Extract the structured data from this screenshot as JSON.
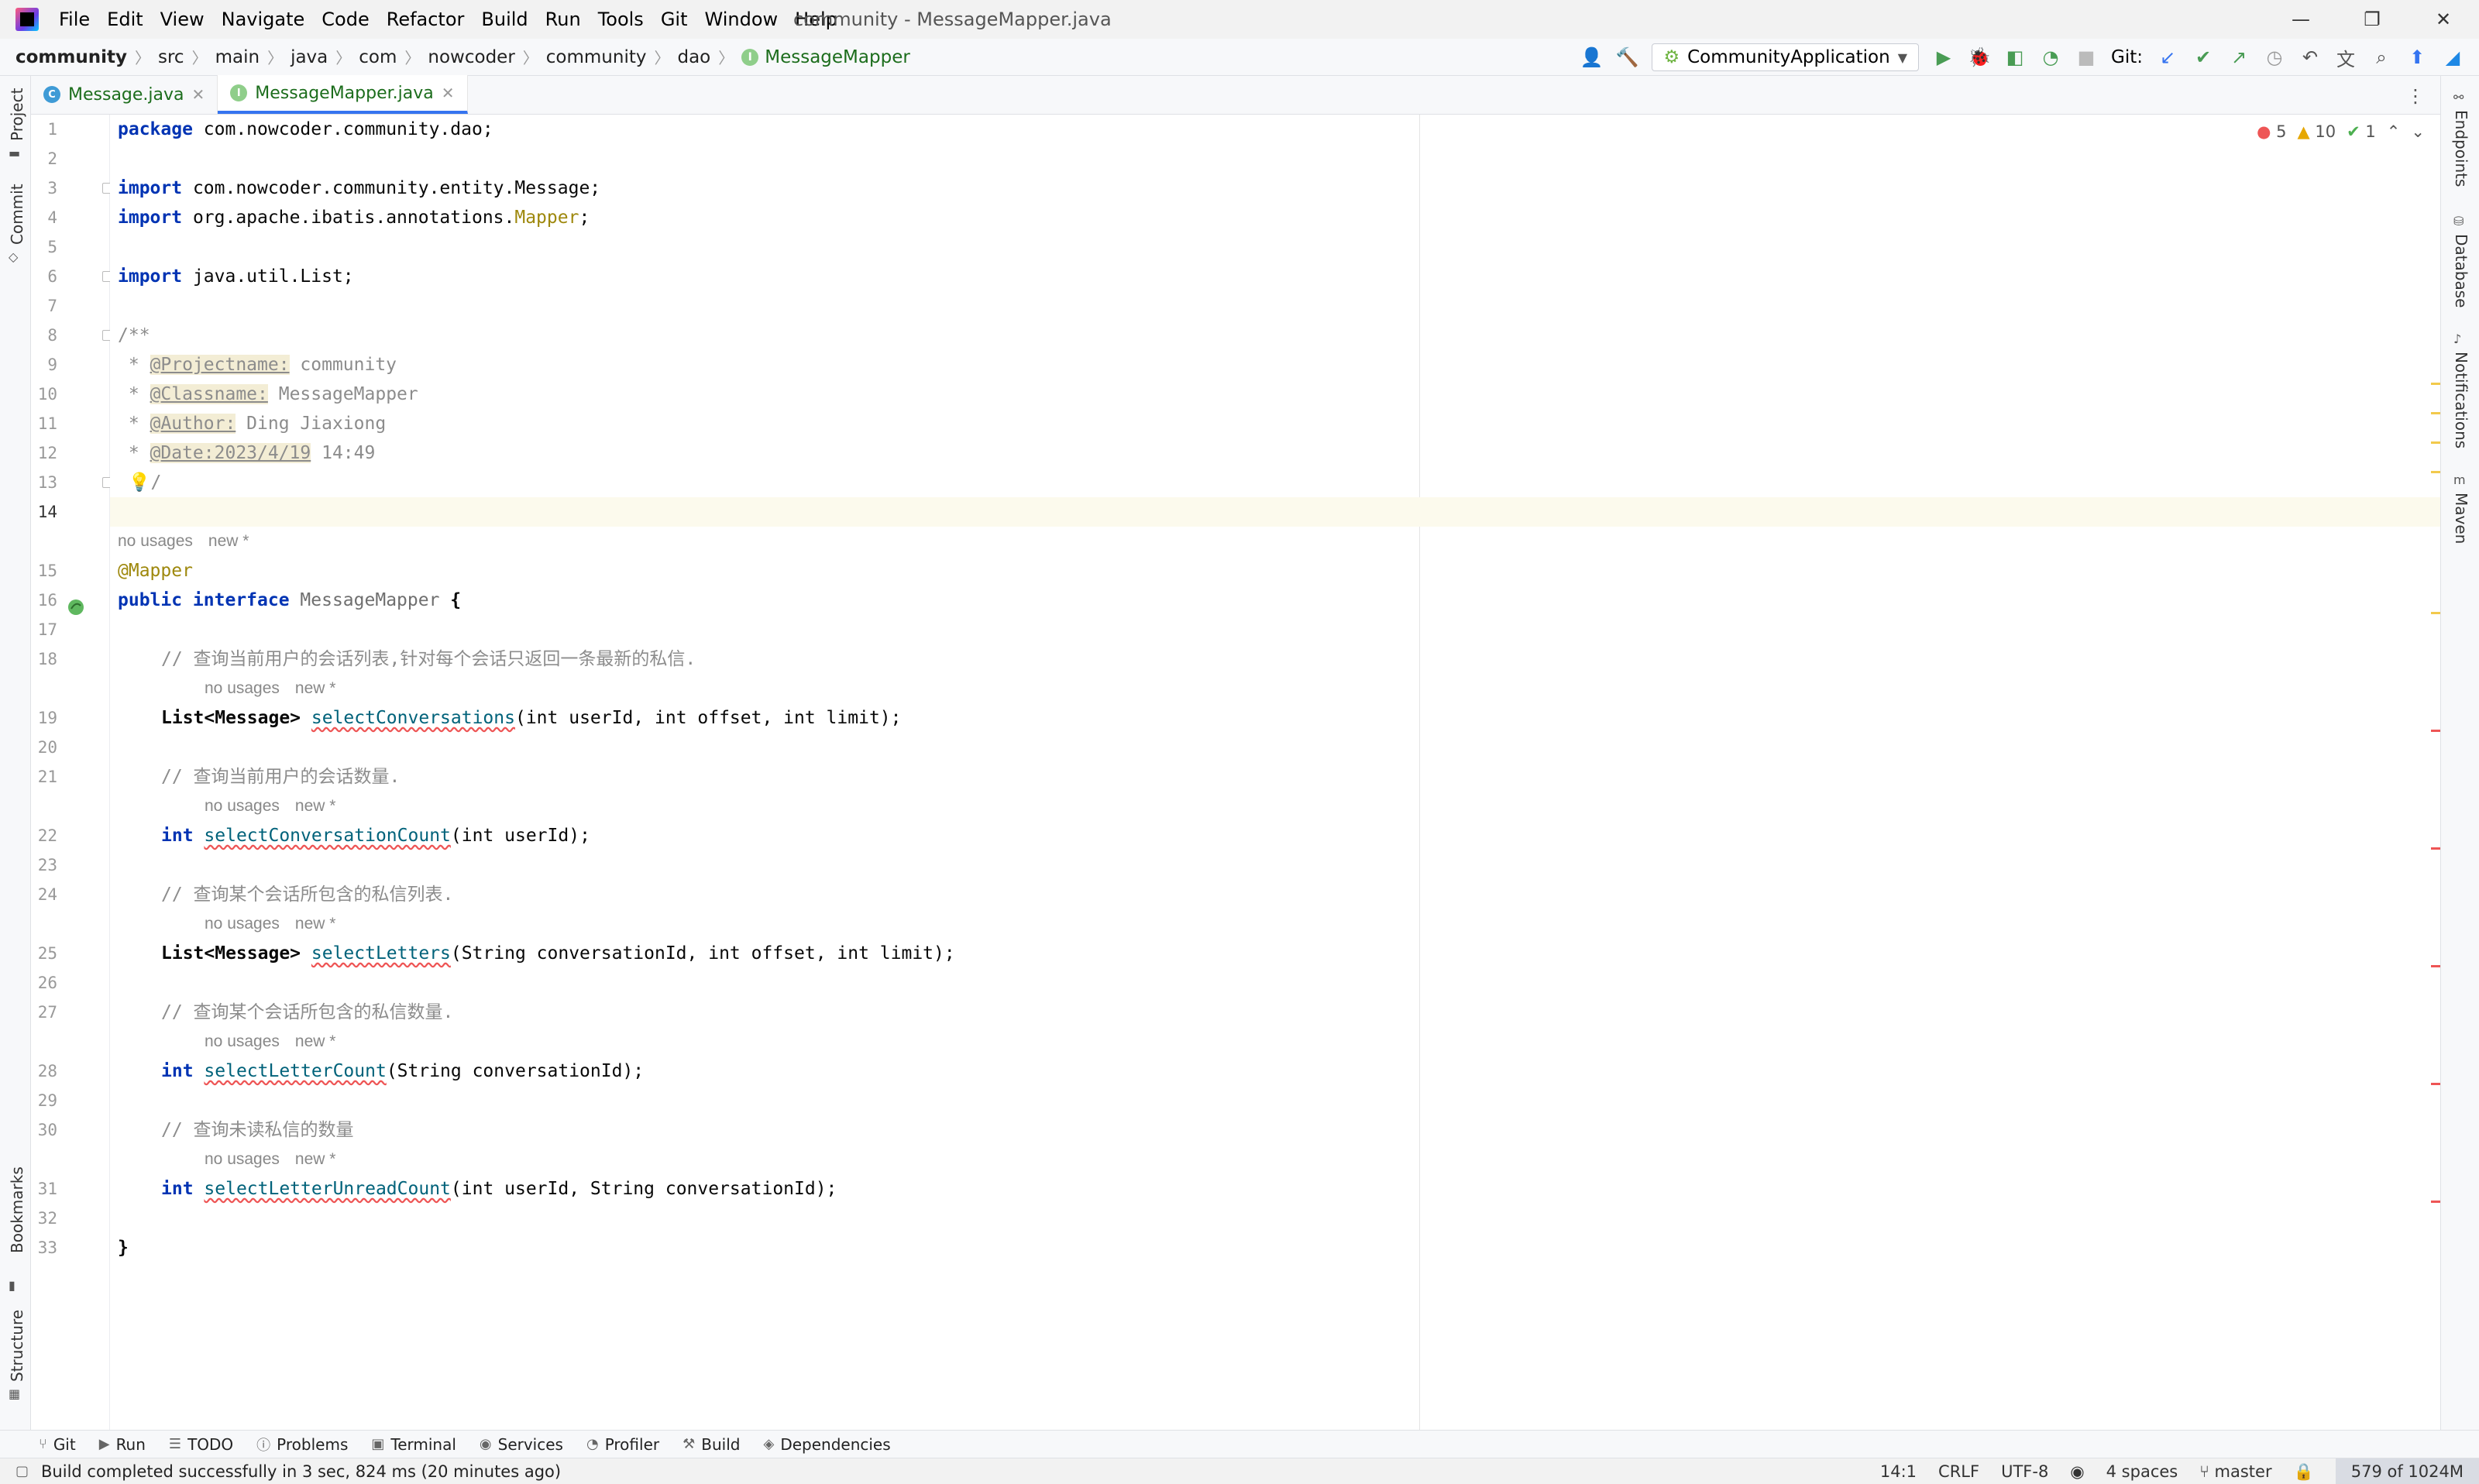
{
  "window": {
    "title": "community - MessageMapper.java",
    "controls": [
      "—",
      "❐",
      "✕"
    ]
  },
  "menu": [
    "File",
    "Edit",
    "View",
    "Navigate",
    "Code",
    "Refactor",
    "Build",
    "Run",
    "Tools",
    "Git",
    "Window",
    "Help"
  ],
  "breadcrumbs": [
    "community",
    "src",
    "main",
    "java",
    "com",
    "nowcoder",
    "community",
    "dao",
    "MessageMapper"
  ],
  "toolbar": {
    "run_config": "CommunityApplication",
    "git_label": "Git:"
  },
  "tabs": [
    {
      "label": "Message.java",
      "icon": "class-icon",
      "active": false
    },
    {
      "label": "MessageMapper.java",
      "icon": "interface-icon",
      "active": true
    }
  ],
  "inspections": {
    "errors": "5",
    "warnings": "10",
    "weak": "1"
  },
  "inlay": {
    "usages": "no usages",
    "author": "new *"
  },
  "code_lines": [
    {
      "n": "1",
      "text": "package com.nowcoder.community.dao;"
    },
    {
      "n": "2",
      "text": ""
    },
    {
      "n": "3",
      "text": "import com.nowcoder.community.entity.Message;"
    },
    {
      "n": "4",
      "text": "import org.apache.ibatis.annotations.Mapper;"
    },
    {
      "n": "5",
      "text": ""
    },
    {
      "n": "6",
      "text": "import java.util.List;"
    },
    {
      "n": "7",
      "text": ""
    },
    {
      "n": "8",
      "text": "/**"
    },
    {
      "n": "9",
      "tag": "@Projectname:",
      "value": " community"
    },
    {
      "n": "10",
      "tag": "@Classname:",
      "value": " MessageMapper"
    },
    {
      "n": "11",
      "tag": "@Author:",
      "value": " Ding Jiaxiong"
    },
    {
      "n": "12",
      "tag": "@Date:2023/4/19",
      "value": " 14:49"
    },
    {
      "n": "13",
      "text": ""
    },
    {
      "n": "14",
      "text": ""
    },
    {
      "n": "15",
      "text": "@Mapper"
    },
    {
      "n": "16",
      "text": "public interface MessageMapper {"
    },
    {
      "n": "17",
      "text": ""
    },
    {
      "n": "18",
      "text": "// 查询当前用户的会话列表,针对每个会话只返回一条最新的私信."
    },
    {
      "n": "19",
      "ret": "List<Message>",
      "method": "selectConversations",
      "params": "(int userId, int offset, int limit);"
    },
    {
      "n": "20",
      "text": ""
    },
    {
      "n": "21",
      "text": "// 查询当前用户的会话数量."
    },
    {
      "n": "22",
      "ret": "int",
      "method": "selectConversationCount",
      "params": "(int userId);"
    },
    {
      "n": "23",
      "text": ""
    },
    {
      "n": "24",
      "text": "// 查询某个会话所包含的私信列表."
    },
    {
      "n": "25",
      "ret": "List<Message>",
      "method": "selectLetters",
      "params": "(String conversationId, int offset, int limit);"
    },
    {
      "n": "26",
      "text": ""
    },
    {
      "n": "27",
      "text": "// 查询某个会话所包含的私信数量."
    },
    {
      "n": "28",
      "ret": "int",
      "method": "selectLetterCount",
      "params": "(String conversationId);"
    },
    {
      "n": "29",
      "text": ""
    },
    {
      "n": "30",
      "text": "// 查询未读私信的数量"
    },
    {
      "n": "31",
      "ret": "int",
      "method": "selectLetterUnreadCount",
      "params": "(int userId, String conversationId);"
    },
    {
      "n": "32",
      "text": ""
    },
    {
      "n": "33",
      "text": "}"
    }
  ],
  "left_tools": [
    "Project",
    "Commit",
    "Bookmarks",
    "Structure"
  ],
  "right_tools": [
    "Endpoints",
    "Database",
    "Notifications",
    "Maven"
  ],
  "bottom_tools": [
    "Git",
    "Run",
    "TODO",
    "Problems",
    "Terminal",
    "Services",
    "Profiler",
    "Build",
    "Dependencies"
  ],
  "status": {
    "message": "Build completed successfully in 3 sec, 824 ms (20 minutes ago)",
    "position": "14:1",
    "line_sep": "CRLF",
    "encoding": "UTF-8",
    "indent": "4 spaces",
    "branch": "master",
    "memory": "579 of 1024M"
  }
}
